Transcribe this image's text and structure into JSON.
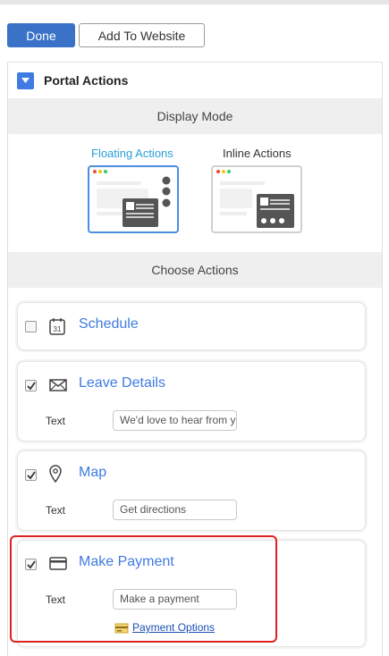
{
  "toolbar": {
    "done_label": "Done",
    "add_label": "Add To Website"
  },
  "panel": {
    "title": "Portal Actions",
    "display_mode": {
      "heading": "Display Mode",
      "options": [
        {
          "label": "Floating Actions",
          "selected": true
        },
        {
          "label": "Inline Actions",
          "selected": false
        }
      ]
    },
    "choose_actions": {
      "heading": "Choose Actions",
      "actions": [
        {
          "title": "Schedule",
          "checked": false,
          "icon": "calendar-icon",
          "calendar_day": "31"
        },
        {
          "title": "Leave Details",
          "checked": true,
          "icon": "envelope-icon",
          "text_label": "Text",
          "text_value": "We'd love to hear from y"
        },
        {
          "title": "Map",
          "checked": true,
          "icon": "map-pin-icon",
          "text_label": "Text",
          "text_value": "Get directions"
        },
        {
          "title": "Make Payment",
          "checked": true,
          "icon": "credit-card-icon",
          "text_label": "Text",
          "text_value": "Make a payment",
          "link_label": "Payment Options"
        }
      ]
    }
  },
  "colors": {
    "primary": "#3a72c8",
    "link": "#3f7be0",
    "selected_mode": "#2a9fd8",
    "highlight": "#e02020"
  }
}
